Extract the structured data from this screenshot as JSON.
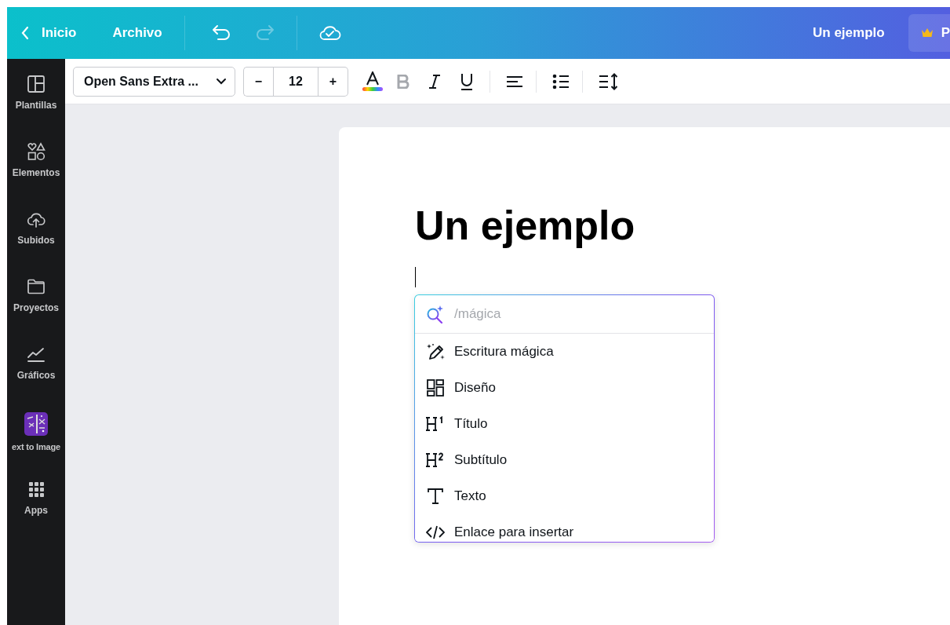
{
  "topbar": {
    "back_label": "Inicio",
    "file_menu": "Archivo",
    "undo": {
      "disabled": false
    },
    "redo": {
      "disabled": true
    },
    "document_title": "Un ejemplo",
    "premium_button": "P"
  },
  "toolbar": {
    "font": "Open Sans Extra ...",
    "decrease": "−",
    "font_size": "12",
    "increase": "+",
    "bold": {
      "disabled": true
    }
  },
  "sidebar": {
    "items": [
      {
        "label": "Plantillas",
        "kind": "templates"
      },
      {
        "label": "Elementos",
        "kind": "elements"
      },
      {
        "label": "Subidos",
        "kind": "uploads"
      },
      {
        "label": "Proyectos",
        "kind": "projects"
      },
      {
        "label": "Gráficos",
        "kind": "charts"
      },
      {
        "label": "ext to Image",
        "kind": "app"
      },
      {
        "label": "Apps",
        "kind": "apps"
      }
    ]
  },
  "document": {
    "heading": "Un ejemplo"
  },
  "insert_menu": {
    "search": {
      "placeholder": "/mágica"
    },
    "items": [
      {
        "label": "Escritura mágica",
        "kind": "magic"
      },
      {
        "label": "Diseño",
        "kind": "layout"
      },
      {
        "label": "Título",
        "kind": "h1"
      },
      {
        "label": "Subtítulo",
        "kind": "h2"
      },
      {
        "label": "Texto",
        "kind": "text"
      },
      {
        "label": "Enlace para insertar",
        "kind": "embed"
      }
    ]
  }
}
